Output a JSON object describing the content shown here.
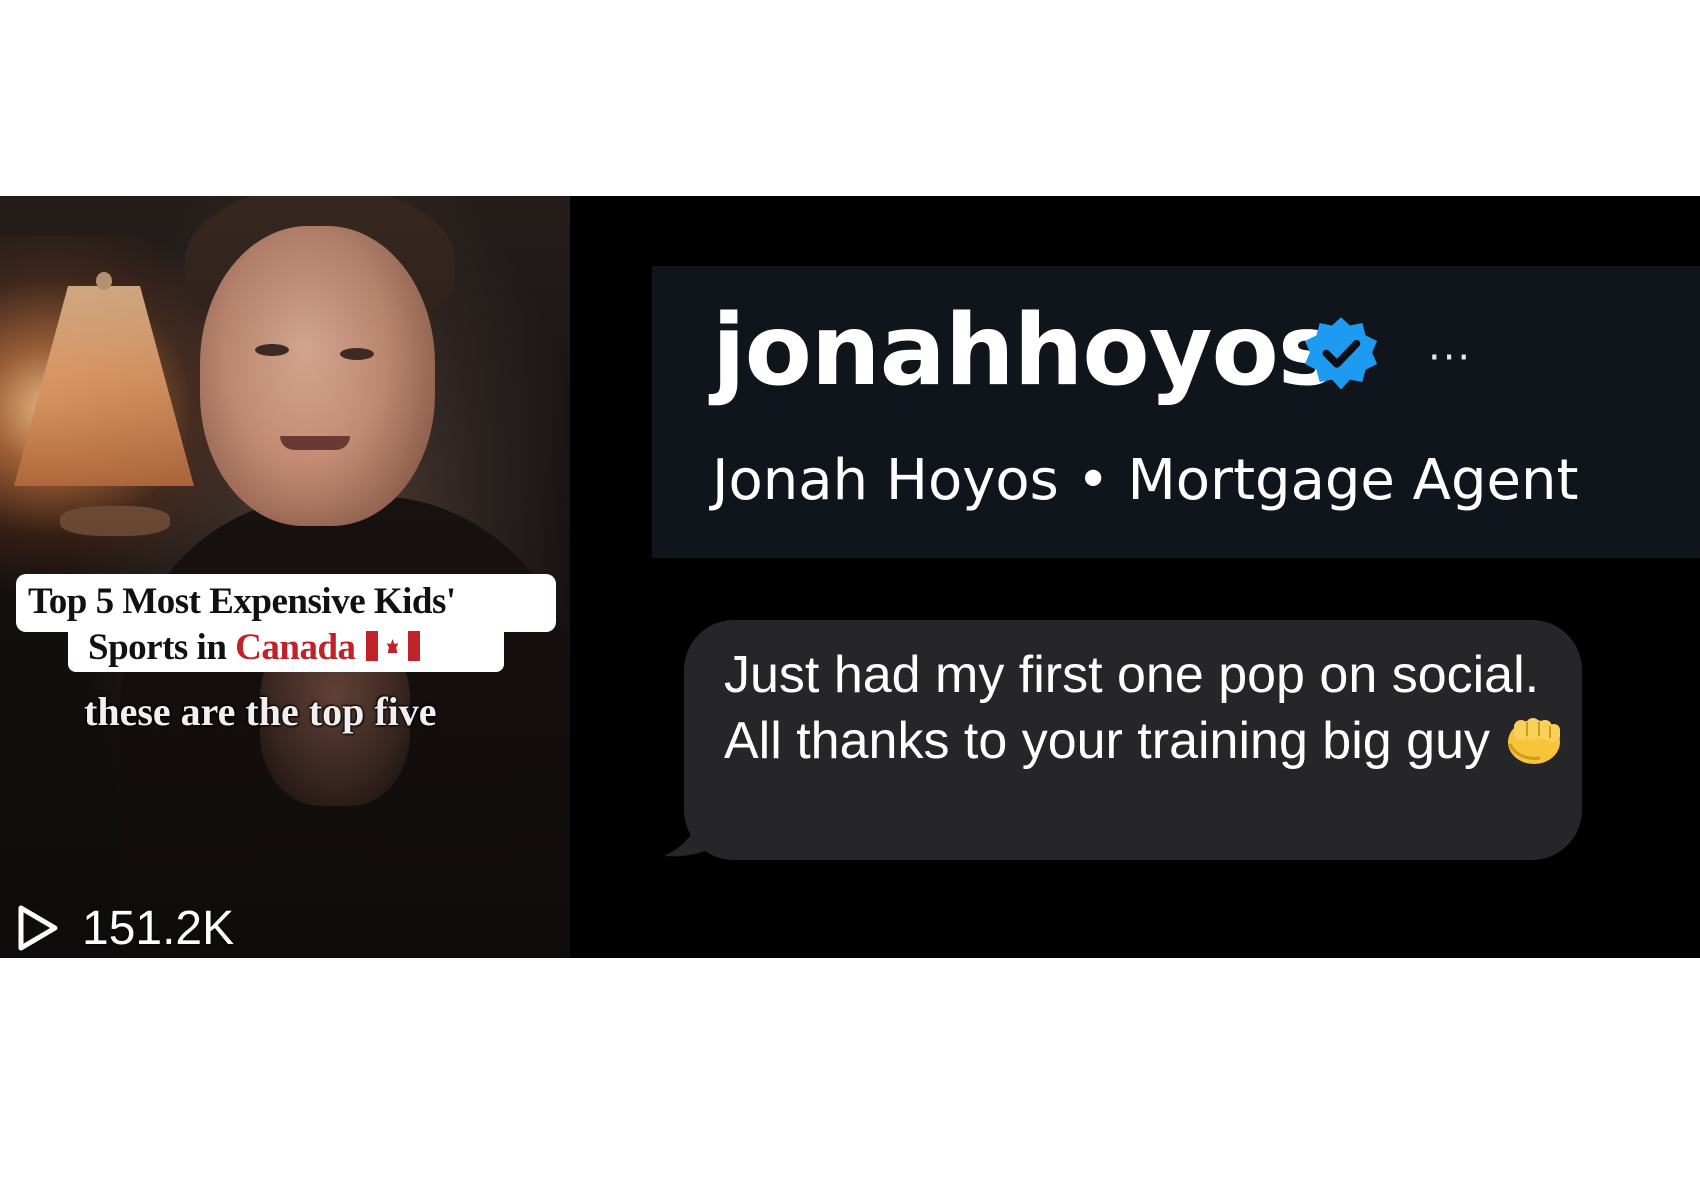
{
  "video": {
    "caption_line1": "Top 5 Most Expensive Kids'",
    "caption_line2_prefix": "Sports in ",
    "caption_line2_highlight": "Canada",
    "flag_icon": "canada-flag-icon",
    "subtitle": "these are the top five",
    "views": "151.2K",
    "play_icon": "play-outline-icon"
  },
  "profile": {
    "username": "jonahhoyos",
    "verified_icon": "verified-badge-icon",
    "verified_color": "#1d9bf0",
    "more_label": "···",
    "display_line": "Jonah Hoyos • Mortgage Agent"
  },
  "message": {
    "text": "Just had my first one pop on social. All thanks to your training big guy",
    "emoji_icon": "fist-bump-icon",
    "bubble_color": "#262629"
  }
}
